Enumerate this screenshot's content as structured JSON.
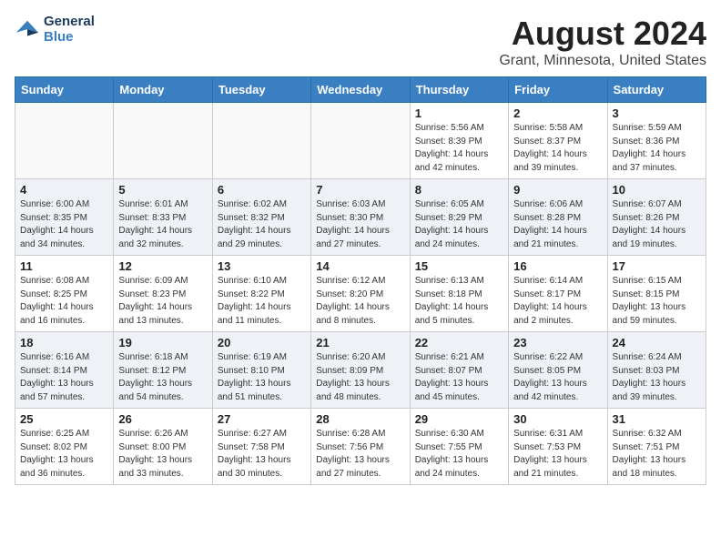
{
  "header": {
    "logo_line1": "General",
    "logo_line2": "Blue",
    "main_title": "August 2024",
    "sub_title": "Grant, Minnesota, United States"
  },
  "weekdays": [
    "Sunday",
    "Monday",
    "Tuesday",
    "Wednesday",
    "Thursday",
    "Friday",
    "Saturday"
  ],
  "weeks": [
    [
      {
        "day": "",
        "info": ""
      },
      {
        "day": "",
        "info": ""
      },
      {
        "day": "",
        "info": ""
      },
      {
        "day": "",
        "info": ""
      },
      {
        "day": "1",
        "info": "Sunrise: 5:56 AM\nSunset: 8:39 PM\nDaylight: 14 hours\nand 42 minutes."
      },
      {
        "day": "2",
        "info": "Sunrise: 5:58 AM\nSunset: 8:37 PM\nDaylight: 14 hours\nand 39 minutes."
      },
      {
        "day": "3",
        "info": "Sunrise: 5:59 AM\nSunset: 8:36 PM\nDaylight: 14 hours\nand 37 minutes."
      }
    ],
    [
      {
        "day": "4",
        "info": "Sunrise: 6:00 AM\nSunset: 8:35 PM\nDaylight: 14 hours\nand 34 minutes."
      },
      {
        "day": "5",
        "info": "Sunrise: 6:01 AM\nSunset: 8:33 PM\nDaylight: 14 hours\nand 32 minutes."
      },
      {
        "day": "6",
        "info": "Sunrise: 6:02 AM\nSunset: 8:32 PM\nDaylight: 14 hours\nand 29 minutes."
      },
      {
        "day": "7",
        "info": "Sunrise: 6:03 AM\nSunset: 8:30 PM\nDaylight: 14 hours\nand 27 minutes."
      },
      {
        "day": "8",
        "info": "Sunrise: 6:05 AM\nSunset: 8:29 PM\nDaylight: 14 hours\nand 24 minutes."
      },
      {
        "day": "9",
        "info": "Sunrise: 6:06 AM\nSunset: 8:28 PM\nDaylight: 14 hours\nand 21 minutes."
      },
      {
        "day": "10",
        "info": "Sunrise: 6:07 AM\nSunset: 8:26 PM\nDaylight: 14 hours\nand 19 minutes."
      }
    ],
    [
      {
        "day": "11",
        "info": "Sunrise: 6:08 AM\nSunset: 8:25 PM\nDaylight: 14 hours\nand 16 minutes."
      },
      {
        "day": "12",
        "info": "Sunrise: 6:09 AM\nSunset: 8:23 PM\nDaylight: 14 hours\nand 13 minutes."
      },
      {
        "day": "13",
        "info": "Sunrise: 6:10 AM\nSunset: 8:22 PM\nDaylight: 14 hours\nand 11 minutes."
      },
      {
        "day": "14",
        "info": "Sunrise: 6:12 AM\nSunset: 8:20 PM\nDaylight: 14 hours\nand 8 minutes."
      },
      {
        "day": "15",
        "info": "Sunrise: 6:13 AM\nSunset: 8:18 PM\nDaylight: 14 hours\nand 5 minutes."
      },
      {
        "day": "16",
        "info": "Sunrise: 6:14 AM\nSunset: 8:17 PM\nDaylight: 14 hours\nand 2 minutes."
      },
      {
        "day": "17",
        "info": "Sunrise: 6:15 AM\nSunset: 8:15 PM\nDaylight: 13 hours\nand 59 minutes."
      }
    ],
    [
      {
        "day": "18",
        "info": "Sunrise: 6:16 AM\nSunset: 8:14 PM\nDaylight: 13 hours\nand 57 minutes."
      },
      {
        "day": "19",
        "info": "Sunrise: 6:18 AM\nSunset: 8:12 PM\nDaylight: 13 hours\nand 54 minutes."
      },
      {
        "day": "20",
        "info": "Sunrise: 6:19 AM\nSunset: 8:10 PM\nDaylight: 13 hours\nand 51 minutes."
      },
      {
        "day": "21",
        "info": "Sunrise: 6:20 AM\nSunset: 8:09 PM\nDaylight: 13 hours\nand 48 minutes."
      },
      {
        "day": "22",
        "info": "Sunrise: 6:21 AM\nSunset: 8:07 PM\nDaylight: 13 hours\nand 45 minutes."
      },
      {
        "day": "23",
        "info": "Sunrise: 6:22 AM\nSunset: 8:05 PM\nDaylight: 13 hours\nand 42 minutes."
      },
      {
        "day": "24",
        "info": "Sunrise: 6:24 AM\nSunset: 8:03 PM\nDaylight: 13 hours\nand 39 minutes."
      }
    ],
    [
      {
        "day": "25",
        "info": "Sunrise: 6:25 AM\nSunset: 8:02 PM\nDaylight: 13 hours\nand 36 minutes."
      },
      {
        "day": "26",
        "info": "Sunrise: 6:26 AM\nSunset: 8:00 PM\nDaylight: 13 hours\nand 33 minutes."
      },
      {
        "day": "27",
        "info": "Sunrise: 6:27 AM\nSunset: 7:58 PM\nDaylight: 13 hours\nand 30 minutes."
      },
      {
        "day": "28",
        "info": "Sunrise: 6:28 AM\nSunset: 7:56 PM\nDaylight: 13 hours\nand 27 minutes."
      },
      {
        "day": "29",
        "info": "Sunrise: 6:30 AM\nSunset: 7:55 PM\nDaylight: 13 hours\nand 24 minutes."
      },
      {
        "day": "30",
        "info": "Sunrise: 6:31 AM\nSunset: 7:53 PM\nDaylight: 13 hours\nand 21 minutes."
      },
      {
        "day": "31",
        "info": "Sunrise: 6:32 AM\nSunset: 7:51 PM\nDaylight: 13 hours\nand 18 minutes."
      }
    ]
  ]
}
